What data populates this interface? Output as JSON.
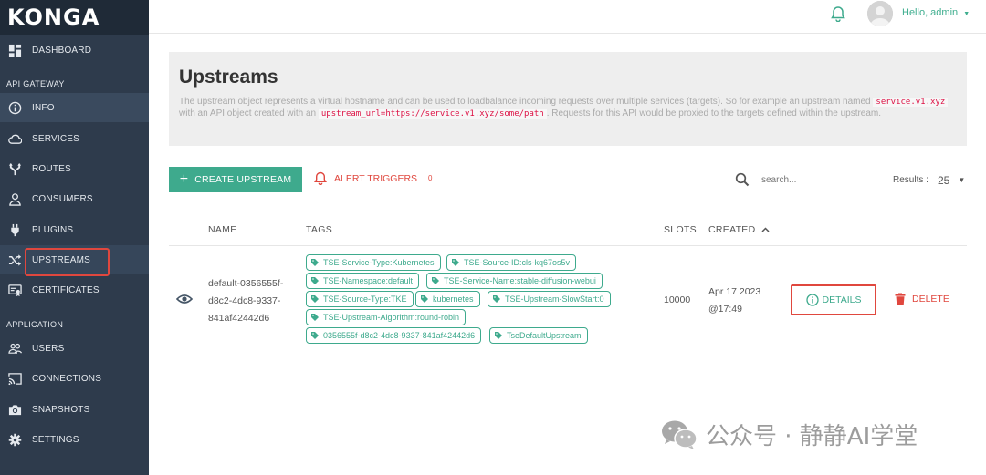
{
  "brand": {
    "name": "KONGA"
  },
  "sidebar": {
    "dashboard": "DASHBOARD",
    "section_api_gateway": "API GATEWAY",
    "info": "INFO",
    "services": "SERVICES",
    "routes": "ROUTES",
    "consumers": "CONSUMERS",
    "plugins": "PLUGINS",
    "upstreams": "UPSTREAMS",
    "certificates": "CERTIFICATES",
    "section_application": "APPLICATION",
    "users": "USERS",
    "connections": "CONNECTIONS",
    "snapshots": "SNAPSHOTS",
    "settings": "SETTINGS"
  },
  "header": {
    "greeting": "Hello, admin"
  },
  "page": {
    "title": "Upstreams",
    "desc_1": "The upstream object represents a virtual hostname and can be used to loadbalance incoming requests over multiple services (targets). So for example an upstream named",
    "desc_code_1": "service.v1.xyz",
    "desc_2": " with an API object created with an ",
    "desc_code_2": "upstream_url=https://service.v1.xyz/some/path",
    "desc_3": ". Requests for this API would be proxied to the targets defined within the upstream."
  },
  "toolbar": {
    "create_label": "CREATE UPSTREAM",
    "alert_label": "ALERT TRIGGERS",
    "alert_count": "0",
    "search_placeholder": "search...",
    "results_label": "Results :",
    "results_value": "25"
  },
  "table": {
    "headers": {
      "name": "NAME",
      "tags": "TAGS",
      "slots": "SLOTS",
      "created": "CREATED"
    },
    "row": {
      "name": "default-0356555f-d8c2-4dc8-9337-841af42442d6",
      "tags": [
        "TSE-Service-Type:Kubernetes",
        "TSE-Source-ID:cls-kq67os5v",
        "TSE-Namespace:default",
        "TSE-Service-Name:stable-diffusion-webui",
        "TSE-Source-Type:TKE",
        "kubernetes",
        "TSE-Upstream-SlowStart:0",
        "TSE-Upstream-Algorithm:round-robin",
        "0356555f-d8c2-4dc8-9337-841af42442d6",
        "TseDefaultUpstream"
      ],
      "slots": "10000",
      "created": "Apr 17 2023 @17:49",
      "details_label": "DETAILS",
      "delete_label": "DELETE"
    }
  },
  "watermark": "公众号 · 静静AI学堂",
  "colors": {
    "accent": "#3eaa8d",
    "danger": "#e0473e",
    "sidebar": "#2e3b4c",
    "brand_bar": "#1f2a37"
  }
}
